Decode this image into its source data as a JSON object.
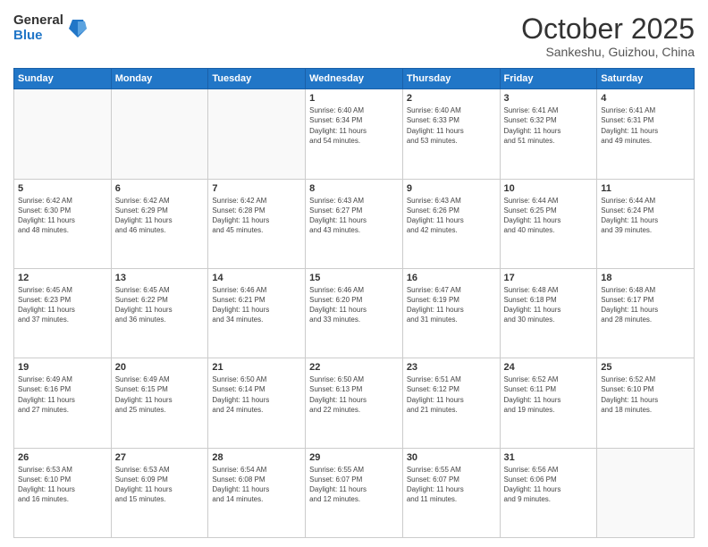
{
  "logo": {
    "general": "General",
    "blue": "Blue"
  },
  "header": {
    "month": "October 2025",
    "location": "Sankeshu, Guizhou, China"
  },
  "weekdays": [
    "Sunday",
    "Monday",
    "Tuesday",
    "Wednesday",
    "Thursday",
    "Friday",
    "Saturday"
  ],
  "weeks": [
    [
      {
        "day": "",
        "info": ""
      },
      {
        "day": "",
        "info": ""
      },
      {
        "day": "",
        "info": ""
      },
      {
        "day": "1",
        "info": "Sunrise: 6:40 AM\nSunset: 6:34 PM\nDaylight: 11 hours\nand 54 minutes."
      },
      {
        "day": "2",
        "info": "Sunrise: 6:40 AM\nSunset: 6:33 PM\nDaylight: 11 hours\nand 53 minutes."
      },
      {
        "day": "3",
        "info": "Sunrise: 6:41 AM\nSunset: 6:32 PM\nDaylight: 11 hours\nand 51 minutes."
      },
      {
        "day": "4",
        "info": "Sunrise: 6:41 AM\nSunset: 6:31 PM\nDaylight: 11 hours\nand 49 minutes."
      }
    ],
    [
      {
        "day": "5",
        "info": "Sunrise: 6:42 AM\nSunset: 6:30 PM\nDaylight: 11 hours\nand 48 minutes."
      },
      {
        "day": "6",
        "info": "Sunrise: 6:42 AM\nSunset: 6:29 PM\nDaylight: 11 hours\nand 46 minutes."
      },
      {
        "day": "7",
        "info": "Sunrise: 6:42 AM\nSunset: 6:28 PM\nDaylight: 11 hours\nand 45 minutes."
      },
      {
        "day": "8",
        "info": "Sunrise: 6:43 AM\nSunset: 6:27 PM\nDaylight: 11 hours\nand 43 minutes."
      },
      {
        "day": "9",
        "info": "Sunrise: 6:43 AM\nSunset: 6:26 PM\nDaylight: 11 hours\nand 42 minutes."
      },
      {
        "day": "10",
        "info": "Sunrise: 6:44 AM\nSunset: 6:25 PM\nDaylight: 11 hours\nand 40 minutes."
      },
      {
        "day": "11",
        "info": "Sunrise: 6:44 AM\nSunset: 6:24 PM\nDaylight: 11 hours\nand 39 minutes."
      }
    ],
    [
      {
        "day": "12",
        "info": "Sunrise: 6:45 AM\nSunset: 6:23 PM\nDaylight: 11 hours\nand 37 minutes."
      },
      {
        "day": "13",
        "info": "Sunrise: 6:45 AM\nSunset: 6:22 PM\nDaylight: 11 hours\nand 36 minutes."
      },
      {
        "day": "14",
        "info": "Sunrise: 6:46 AM\nSunset: 6:21 PM\nDaylight: 11 hours\nand 34 minutes."
      },
      {
        "day": "15",
        "info": "Sunrise: 6:46 AM\nSunset: 6:20 PM\nDaylight: 11 hours\nand 33 minutes."
      },
      {
        "day": "16",
        "info": "Sunrise: 6:47 AM\nSunset: 6:19 PM\nDaylight: 11 hours\nand 31 minutes."
      },
      {
        "day": "17",
        "info": "Sunrise: 6:48 AM\nSunset: 6:18 PM\nDaylight: 11 hours\nand 30 minutes."
      },
      {
        "day": "18",
        "info": "Sunrise: 6:48 AM\nSunset: 6:17 PM\nDaylight: 11 hours\nand 28 minutes."
      }
    ],
    [
      {
        "day": "19",
        "info": "Sunrise: 6:49 AM\nSunset: 6:16 PM\nDaylight: 11 hours\nand 27 minutes."
      },
      {
        "day": "20",
        "info": "Sunrise: 6:49 AM\nSunset: 6:15 PM\nDaylight: 11 hours\nand 25 minutes."
      },
      {
        "day": "21",
        "info": "Sunrise: 6:50 AM\nSunset: 6:14 PM\nDaylight: 11 hours\nand 24 minutes."
      },
      {
        "day": "22",
        "info": "Sunrise: 6:50 AM\nSunset: 6:13 PM\nDaylight: 11 hours\nand 22 minutes."
      },
      {
        "day": "23",
        "info": "Sunrise: 6:51 AM\nSunset: 6:12 PM\nDaylight: 11 hours\nand 21 minutes."
      },
      {
        "day": "24",
        "info": "Sunrise: 6:52 AM\nSunset: 6:11 PM\nDaylight: 11 hours\nand 19 minutes."
      },
      {
        "day": "25",
        "info": "Sunrise: 6:52 AM\nSunset: 6:10 PM\nDaylight: 11 hours\nand 18 minutes."
      }
    ],
    [
      {
        "day": "26",
        "info": "Sunrise: 6:53 AM\nSunset: 6:10 PM\nDaylight: 11 hours\nand 16 minutes."
      },
      {
        "day": "27",
        "info": "Sunrise: 6:53 AM\nSunset: 6:09 PM\nDaylight: 11 hours\nand 15 minutes."
      },
      {
        "day": "28",
        "info": "Sunrise: 6:54 AM\nSunset: 6:08 PM\nDaylight: 11 hours\nand 14 minutes."
      },
      {
        "day": "29",
        "info": "Sunrise: 6:55 AM\nSunset: 6:07 PM\nDaylight: 11 hours\nand 12 minutes."
      },
      {
        "day": "30",
        "info": "Sunrise: 6:55 AM\nSunset: 6:07 PM\nDaylight: 11 hours\nand 11 minutes."
      },
      {
        "day": "31",
        "info": "Sunrise: 6:56 AM\nSunset: 6:06 PM\nDaylight: 11 hours\nand 9 minutes."
      },
      {
        "day": "",
        "info": ""
      }
    ]
  ]
}
